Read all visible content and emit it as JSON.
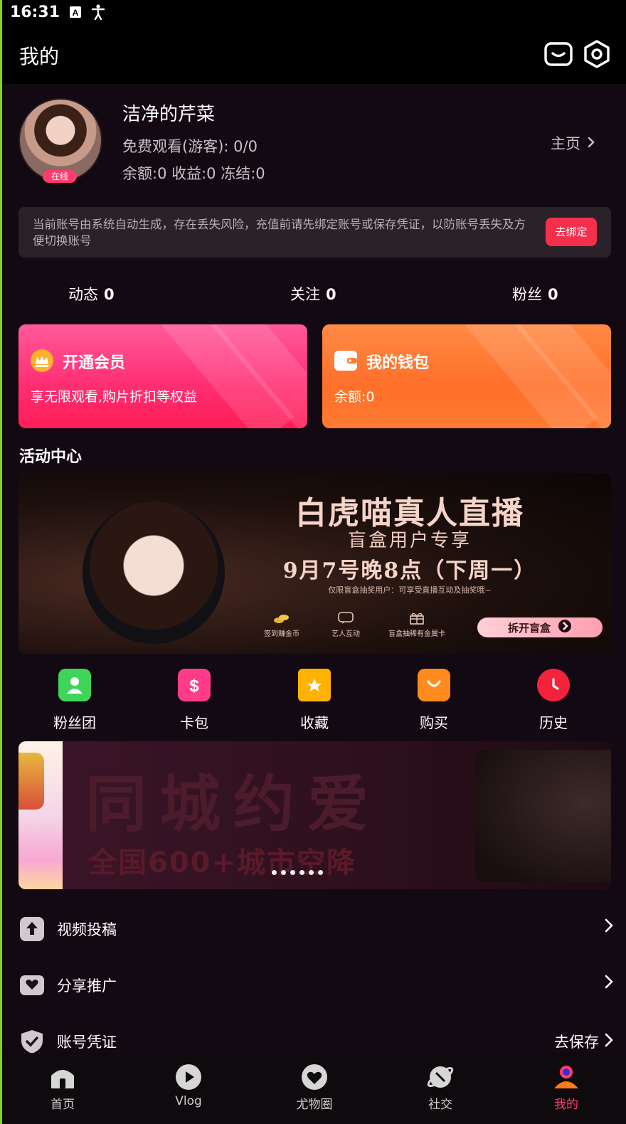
{
  "status_bar": {
    "time": "16:31"
  },
  "header": {
    "title": "我的"
  },
  "profile": {
    "name": "洁净的芹菜",
    "online_badge": "在线",
    "free_watch": "免费观看(游客): 0/0",
    "balance_line": "余额:0 收益:0 冻结:0",
    "homepage_link": "主页"
  },
  "notice": {
    "text": "当前账号由系统自动生成，存在丢失风险，充值前请先绑定账号或保存凭证，以防账号丢失及方便切换账号",
    "button": "去绑定"
  },
  "stats": [
    {
      "label": "动态",
      "value": "0"
    },
    {
      "label": "关注",
      "value": "0"
    },
    {
      "label": "粉丝",
      "value": "0"
    }
  ],
  "cards": {
    "vip": {
      "title": "开通会员",
      "subtitle": "享无限观看,购片折扣等权益"
    },
    "wallet": {
      "title": "我的钱包",
      "subtitle": "余额:0"
    }
  },
  "activity_section": {
    "title": "活动中心"
  },
  "banner1": {
    "title": "白虎喵真人直播",
    "subtitle": "盲盒用户专享",
    "date": "9月7号晚8点（下周一）",
    "note": "仅限盲盒抽奖用户：可享受直播互动及抽奖哦~",
    "features": [
      "签到赚金币",
      "艺人互动",
      "盲盒抽稀有金属卡"
    ],
    "button": "拆开盲盒"
  },
  "quick_actions": [
    {
      "label": "粉丝团",
      "icon": "fan-club-icon",
      "color": "#3fd45a"
    },
    {
      "label": "卡包",
      "icon": "card-wallet-icon",
      "color": "#ff3c8a"
    },
    {
      "label": "收藏",
      "icon": "favorite-icon",
      "color": "#ffb300"
    },
    {
      "label": "购买",
      "icon": "shopping-bag-icon",
      "color": "#ff8a1e"
    },
    {
      "label": "历史",
      "icon": "history-clock-icon",
      "color": "#f2233b"
    }
  ],
  "banner2": {
    "title": "同城约爱",
    "subtitle": "全国600+城市空降",
    "pages": 6
  },
  "menu": [
    {
      "label": "视频投稿",
      "icon": "upload-icon",
      "right": ""
    },
    {
      "label": "分享推广",
      "icon": "share-icon",
      "right": ""
    },
    {
      "label": "账号凭证",
      "icon": "shield-check-icon",
      "right": "去保存"
    }
  ],
  "tabbar": [
    {
      "label": "首页",
      "icon": "home-icon",
      "active": false
    },
    {
      "label": "Vlog",
      "icon": "play-icon",
      "active": false
    },
    {
      "label": "尤物圈",
      "icon": "heart-circle-icon",
      "active": false
    },
    {
      "label": "社交",
      "icon": "planet-icon",
      "active": false
    },
    {
      "label": "我的",
      "icon": "profile-icon",
      "active": true
    }
  ],
  "colors": {
    "accent": "#ff3f6e",
    "bind_button": "#f42f4c",
    "background": "#130912"
  }
}
